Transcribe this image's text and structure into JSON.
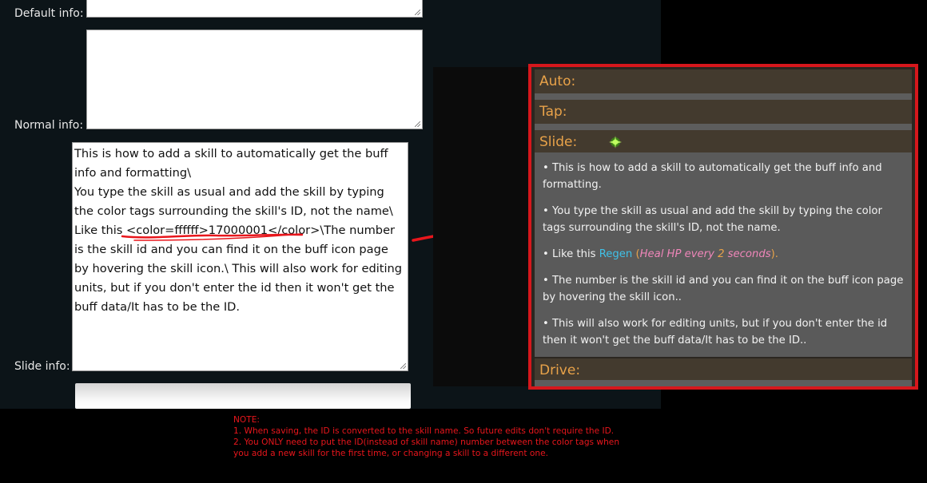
{
  "form": {
    "default_info_label": "Default info:",
    "normal_info_label": "Normal info:",
    "slide_info_label": "Slide info:",
    "slide_text_before": "This is how to add a skill to automatically get the buff info and formatting\\\nYou type the skill as usual and add the skill by typing the color tags surrounding the skill's ID, not the name\\\nLike this ",
    "slide_tag": "<color=ffffff>17000001</color>",
    "slide_text_after": "\\The number is the skill id and you can find it on the buff icon page by hovering the skill icon.\\ This will also work for editing units, but if you don't enter the id then it won't get the buff data/It has to be the ID."
  },
  "preview": {
    "auto_label": "Auto:",
    "tap_label": "Tap:",
    "slide_label": "Slide:",
    "drive_label": "Drive:",
    "bullets": {
      "b1": "• This is how to add a skill to automatically get the buff info and formatting.",
      "b2": "• You type the skill as usual and add the skill by typing the color tags surrounding the skill's ID, not the name.",
      "b3_prefix": "• Like this ",
      "b3_skill": "Regen",
      "b3_open": " (",
      "b3_effect": "Heal HP every ",
      "b3_num": "2",
      "b3_unit": " seconds",
      "b3_close": ").",
      "b4": "• The number is the skill id and you can find it on the buff icon page by hovering the skill icon..",
      "b5": "• This will also work for editing units, but if you don't enter the id then it won't get the buff data/It has to be the ID.."
    }
  },
  "note": {
    "title": "NOTE:",
    "line1": "1. When saving, the ID is converted to the skill name. So future edits don't require the ID.",
    "line2": "2. You ONLY need to put the ID(instead of skill name) number between the color tags when",
    "line3": "you add a new skill for the first time, or changing a skill to a different one."
  },
  "colors": {
    "highlight_border": "#d6171c",
    "annotation": "#e8161c",
    "heading_orange": "#e8a249",
    "skill_cyan": "#3fc1e8",
    "effect_pink": "#ef86b9"
  }
}
